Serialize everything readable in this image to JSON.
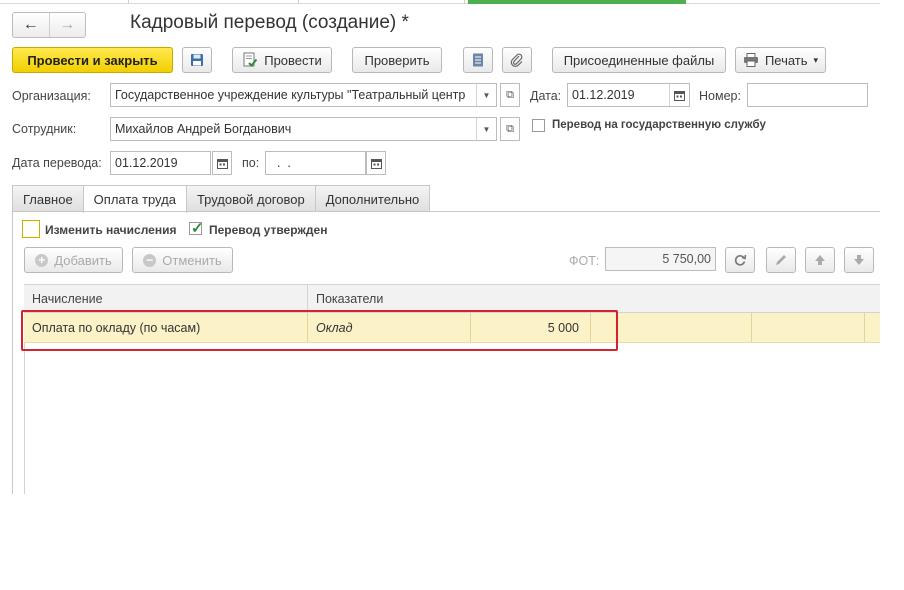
{
  "window": {
    "title": "Кадровый перевод (создание) *",
    "back_icon": "←",
    "forward_icon": "→"
  },
  "toolbar": {
    "post_and_close": "Провести и закрыть",
    "post": "Провести",
    "check": "Проверить",
    "attached_files": "Присоединенные файлы",
    "print": "Печать",
    "print_arrow": "▾"
  },
  "form": {
    "org_label": "Организация:",
    "org_value": "Государственное учреждение культуры \"Театральный центр",
    "date_label": "Дата:",
    "date_value": "01.12.2019",
    "number_label": "Номер:",
    "number_value": "",
    "employee_label": "Сотрудник:",
    "employee_value": "Михайлов Андрей Богданович",
    "civil_service_label": "Перевод на государственную службу",
    "civil_service_checked": false,
    "transfer_date_label": "Дата перевода:",
    "transfer_date_value": "01.12.2019",
    "to_label": "по:",
    "to_value": "  .  .    "
  },
  "tabs": [
    {
      "label": "Главное",
      "active": false
    },
    {
      "label": "Оплата труда",
      "active": true
    },
    {
      "label": "Трудовой договор",
      "active": false
    },
    {
      "label": "Дополнительно",
      "active": false
    }
  ],
  "pay": {
    "change_accruals_label": "Изменить начисления",
    "change_accruals_checked": false,
    "approved_label": "Перевод утвержден",
    "approved_checked": true,
    "add_label": "Добавить",
    "cancel_label": "Отменить",
    "fot_label": "ФОТ:",
    "fot_value": "5 750,00"
  },
  "table": {
    "headers": [
      "Начисление",
      "Показатели"
    ],
    "rows": [
      {
        "accrual": "Оплата по окладу (по часам)",
        "indicator": "Оклад",
        "value": "5 000"
      }
    ]
  },
  "colors": {
    "primary_button": "#f2cf00",
    "selected_row": "#fbf3c7",
    "highlight_frame": "#d4232f",
    "check_mark": "#2e8b3c"
  }
}
